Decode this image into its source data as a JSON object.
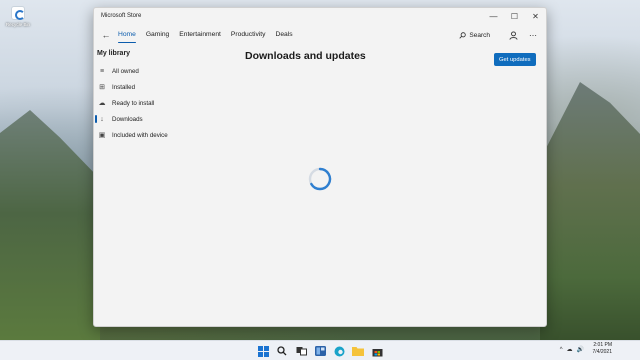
{
  "desktop": {
    "icons": [
      {
        "label": "Recycle Bin",
        "icon": "recycle-bin-icon"
      }
    ]
  },
  "window": {
    "title": "Microsoft Store",
    "controls": {
      "minimize": "—",
      "maximize": "☐",
      "close": "✕"
    }
  },
  "nav": {
    "back_icon": "←",
    "tabs": [
      "Home",
      "Gaming",
      "Entertainment",
      "Productivity",
      "Deals"
    ],
    "active_tab": "Home",
    "search_label": "Search",
    "more_icon": "⋯"
  },
  "library": {
    "heading": "My library",
    "items": [
      {
        "label": "All owned",
        "icon": "stack-icon",
        "glyph": "≡"
      },
      {
        "label": "Installed",
        "icon": "grid-icon",
        "glyph": "⊞"
      },
      {
        "label": "Ready to install",
        "icon": "cloud-icon",
        "glyph": "☁"
      },
      {
        "label": "Downloads",
        "icon": "download-icon",
        "glyph": "↓"
      },
      {
        "label": "Included with device",
        "icon": "bag-icon",
        "glyph": "▣"
      }
    ],
    "active_item": "Downloads"
  },
  "main": {
    "title": "Downloads and updates",
    "get_updates_label": "Get updates",
    "loading": true
  },
  "taskbar": {
    "icons": [
      "start-icon",
      "search-icon",
      "task-view-icon",
      "widgets-icon",
      "edge-icon",
      "file-explorer-icon",
      "store-icon"
    ],
    "tray": [
      "^",
      "☁",
      "🔊"
    ],
    "time": "2:01 PM",
    "date": "7/4/2021"
  },
  "colors": {
    "accent": "#0f6cbd",
    "window_bg": "#f3f3f3",
    "taskbar_bg": "#eef1f6"
  }
}
